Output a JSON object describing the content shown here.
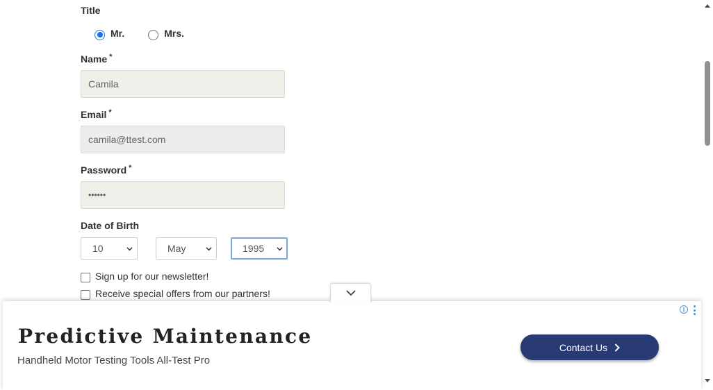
{
  "form": {
    "title_label": "Title",
    "title_options": [
      {
        "label": "Mr.",
        "checked": true
      },
      {
        "label": "Mrs.",
        "checked": false
      }
    ],
    "name_label": "Name",
    "name_value": "Camila",
    "email_label": "Email",
    "email_value": "camila@ttest.com",
    "password_label": "Password",
    "password_value": "••••••",
    "required_mark": "*",
    "dob_label": "Date of Birth",
    "dob_day": "10",
    "dob_month": "May",
    "dob_year": "1995",
    "newsletter_label": "Sign up for our newsletter!",
    "offers_label": "Receive special offers from our partners!"
  },
  "ad": {
    "title": "Predictive Maintenance",
    "subtitle": "Handheld Motor Testing Tools All-Test Pro",
    "button_label": "Contact Us",
    "info_glyph": "i",
    "button_color": "#283a73"
  },
  "icons": {
    "select_chevron": "chevron-down-icon",
    "toggle": "chevron-down-icon",
    "button_arrow": "chevron-right-icon",
    "info": "info-icon",
    "menu": "more-vert-icon"
  },
  "colors": {
    "accent": "#1a73e8",
    "field_bg": "#efeee8"
  }
}
